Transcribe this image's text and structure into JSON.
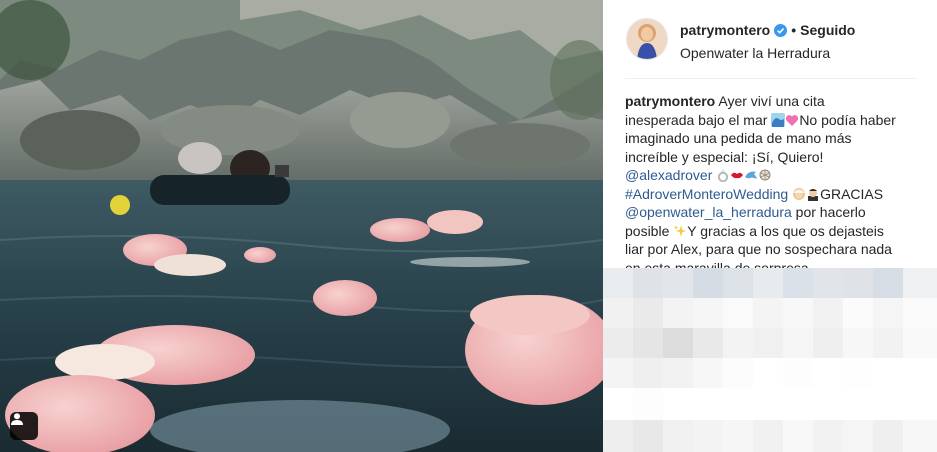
{
  "header": {
    "username": "patrymontero",
    "verified": true,
    "separator": "•",
    "follow_state": "Seguido",
    "location": "Openwater la Herradura"
  },
  "caption": {
    "username": "patrymontero",
    "line1": "Ayer viví una cita",
    "line2": "inesperada bajo el mar",
    "line2_end": "No podía haber",
    "line3": "imaginado una pedida de mano más",
    "line4": "increíble y especial: ¡Sí, Quiero!",
    "mention1": "@alexadrover",
    "hashtag": "#AdroverMonteroWedding",
    "line6_end": "GRACIAS",
    "mention2": "@openwater_la_herradura",
    "line7_end": "por hacerlo",
    "line8_start": "posible",
    "line8_end": "Y gracias a los que os dejasteis",
    "line9": "liar por Alex, para que no sospechara nada",
    "line10": "en esta maravilla de sorpresa."
  },
  "icons": {
    "verified": "verified-badge-icon",
    "tag": "user-tag-icon",
    "emoji_wave": "wave-emoji",
    "emoji_heart": "pink-heart-emoji",
    "emoji_ring": "ring-emoji",
    "emoji_kiss": "kiss-lips-emoji",
    "emoji_dolphin": "dolphin-emoji",
    "emoji_sparkles": "sparkles-emoji",
    "emoji_bride": "bride-emoji",
    "emoji_groom": "groom-emoji"
  },
  "colors": {
    "verified_blue": "#3897f0",
    "link_blue": "#2e5b8f",
    "text": "#262626",
    "divider": "#efefef"
  }
}
